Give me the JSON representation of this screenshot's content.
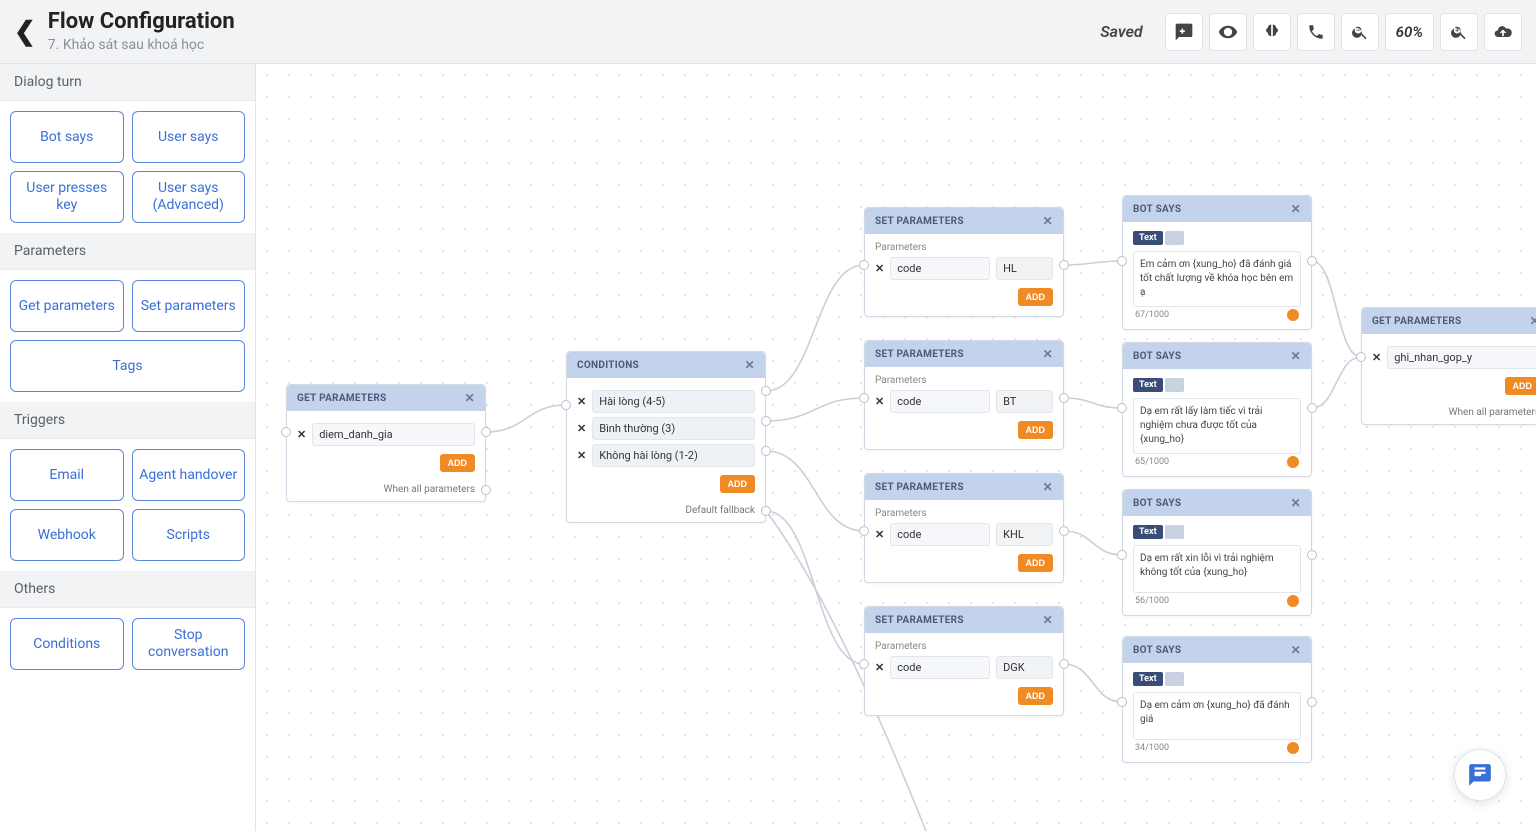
{
  "header": {
    "title": "Flow Configuration",
    "subtitle": "7. Khảo sát sau khoá học",
    "saved": "Saved",
    "zoom": "60%"
  },
  "sidebar": {
    "sections": [
      {
        "title": "Dialog turn",
        "items": [
          "Bot says",
          "User says",
          "User presses key",
          "User says (Advanced)"
        ]
      },
      {
        "title": "Parameters",
        "items": [
          "Get parameters",
          "Set parameters",
          "Tags"
        ]
      },
      {
        "title": "Triggers",
        "items": [
          "Email",
          "Agent handover",
          "Webhook",
          "Scripts"
        ]
      },
      {
        "title": "Others",
        "items": [
          "Conditions",
          "Stop conversation"
        ]
      }
    ]
  },
  "labels": {
    "add": "ADD",
    "parameters": "Parameters",
    "text_pill": "Text",
    "when_all": "When all parameters",
    "default_fallback": "Default fallback"
  },
  "nodes": {
    "get1": {
      "title": "GET PARAMETERS",
      "param": "diem_danh_gia"
    },
    "cond": {
      "title": "CONDITIONS",
      "rows": [
        "Hài lòng (4-5)",
        "Bình thường (3)",
        "Không hài lòng (1-2)"
      ]
    },
    "set1": {
      "title": "SET PARAMETERS",
      "key": "code",
      "val": "HL"
    },
    "set2": {
      "title": "SET PARAMETERS",
      "key": "code",
      "val": "BT"
    },
    "set3": {
      "title": "SET PARAMETERS",
      "key": "code",
      "val": "KHL"
    },
    "set4": {
      "title": "SET PARAMETERS",
      "key": "code",
      "val": "DGK"
    },
    "bot1": {
      "title": "BOT SAYS",
      "text": "Em cảm ơn {xung_ho} đã đánh giá tốt chất lượng về khóa học bên em ạ",
      "count": "67/1000"
    },
    "bot2": {
      "title": "BOT SAYS",
      "text": "Dạ em rất lấy làm tiếc vì trải nghiệm chưa được tốt của {xung_ho}",
      "count": "65/1000"
    },
    "bot3": {
      "title": "BOT SAYS",
      "text": "Dạ em rất xin lỗi vì trải nghiệm không tốt của {xung_ho}",
      "count": "56/1000"
    },
    "bot4": {
      "title": "BOT SAYS",
      "text": "Dạ em cảm ơn {xung_ho} đã đánh giá",
      "count": "34/1000"
    },
    "get2": {
      "title": "GET PARAMETERS",
      "param": "ghi_nhan_gop_y"
    }
  }
}
